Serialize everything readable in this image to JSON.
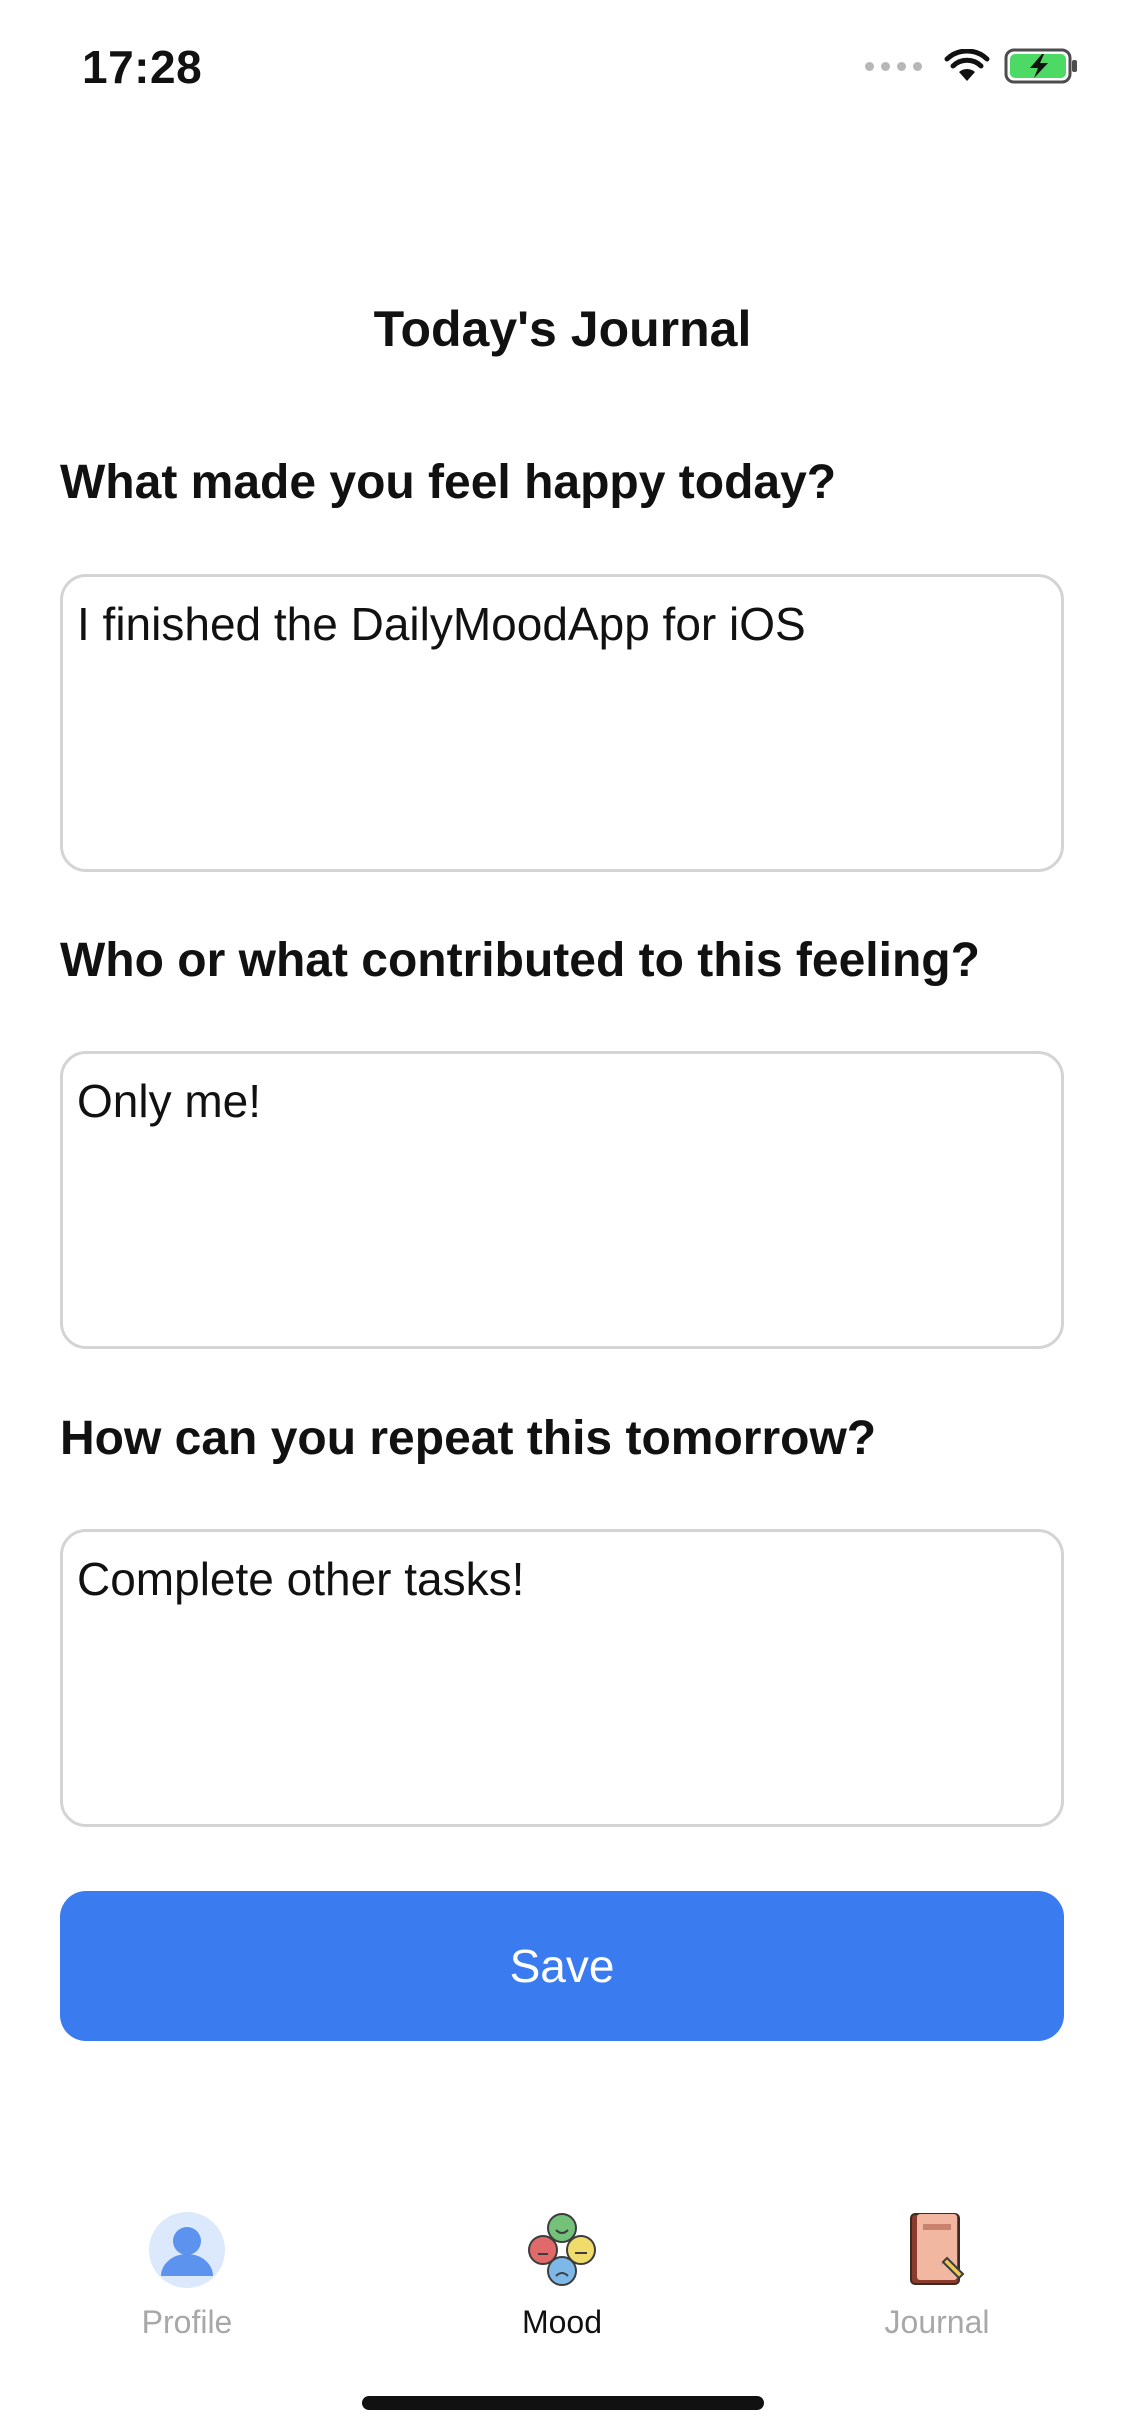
{
  "status_bar": {
    "time": "17:28"
  },
  "page": {
    "title": "Today's Journal"
  },
  "journal": {
    "questions": [
      {
        "prompt": "What made you feel happy today?",
        "answer": "I finished the DailyMoodApp for iOS"
      },
      {
        "prompt": "Who or what contributed to this feeling?",
        "answer": "Only me!"
      },
      {
        "prompt": "How can you repeat this tomorrow?",
        "answer": "Complete other tasks!"
      }
    ],
    "save_label": "Save"
  },
  "tab_bar": {
    "tabs": [
      {
        "label": "Profile",
        "icon": "person-avatar-icon",
        "active": false
      },
      {
        "label": "Mood",
        "icon": "mood-faces-icon",
        "active": true
      },
      {
        "label": "Journal",
        "icon": "journal-book-icon",
        "active": false
      }
    ]
  },
  "colors": {
    "accent": "#3a7cf0",
    "battery": "#4cd964",
    "inactive_tab": "#a8a8a8"
  }
}
